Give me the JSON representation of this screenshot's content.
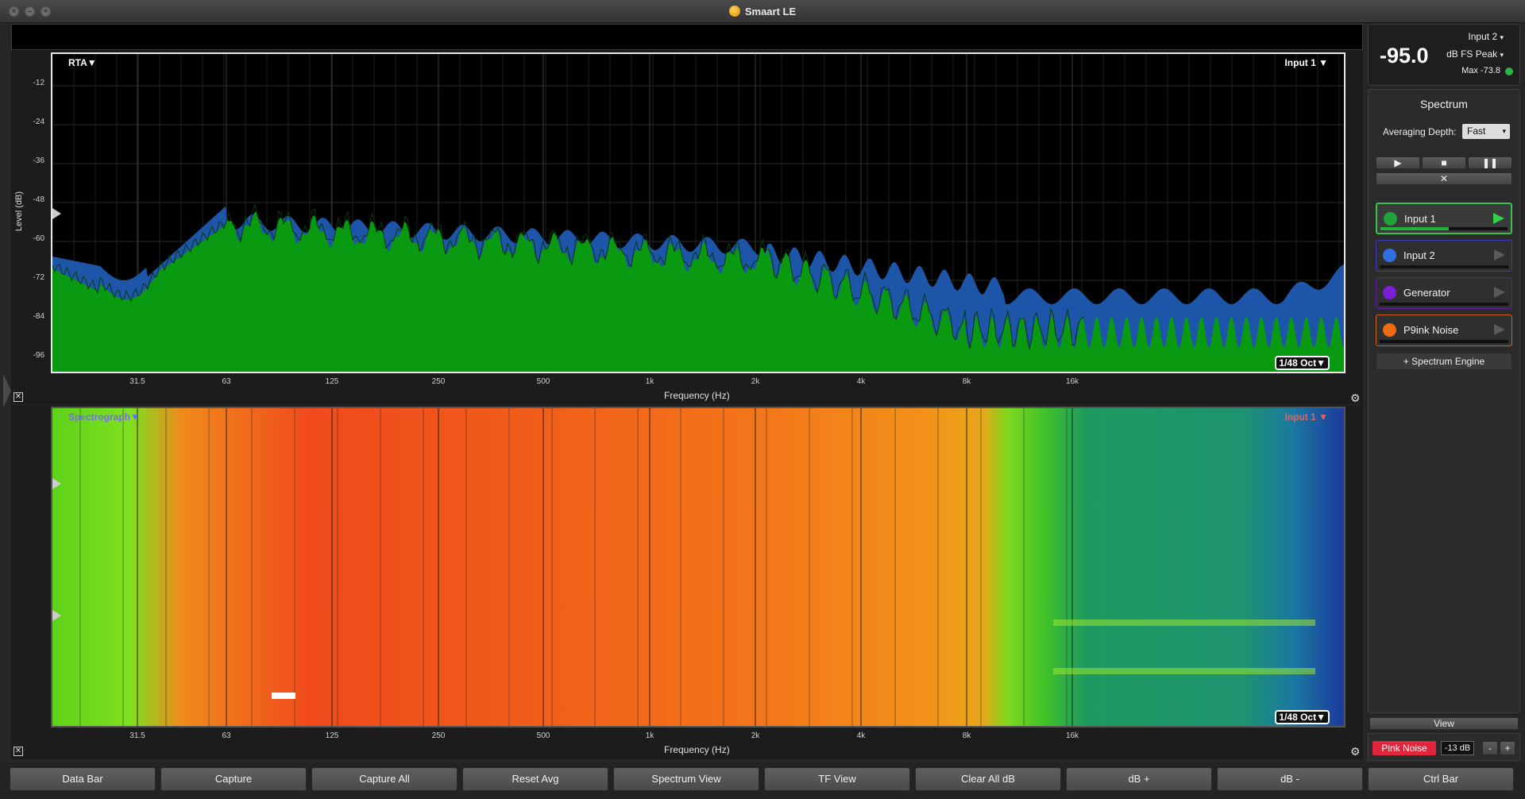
{
  "window": {
    "title": "Smaart LE"
  },
  "rta": {
    "mode_label": "RTA",
    "input_label": "Input 1",
    "resolution": "1/48 Oct",
    "y_axis_label": "Level (dB)",
    "y_ticks": [
      "-12",
      "-24",
      "-36",
      "-48",
      "-60",
      "-72",
      "-84",
      "-96"
    ],
    "x_ticks": [
      "31.5",
      "63",
      "125",
      "250",
      "500",
      "1k",
      "2k",
      "4k",
      "8k",
      "16k"
    ],
    "x_axis_label": "Frequency (Hz)"
  },
  "spectrograph": {
    "mode_label": "Spectrograph",
    "input_label": "Input 1",
    "resolution": "1/48 Oct",
    "x_ticks": [
      "31.5",
      "63",
      "125",
      "250",
      "500",
      "1k",
      "2k",
      "4k",
      "8k",
      "16k"
    ],
    "x_axis_label": "Frequency (Hz)"
  },
  "meter": {
    "value": "-95.0",
    "input": "Input 2",
    "unit": "dB FS Peak",
    "max": "Max -73.8",
    "status_color": "#2db34a"
  },
  "spectrum_panel": {
    "title": "Spectrum",
    "averaging_label": "Averaging Depth:",
    "averaging_value": "Fast",
    "channels": [
      {
        "label": "Input 1",
        "color": "#1fa33a",
        "border": "#39c24a"
      },
      {
        "label": "Input 2",
        "color": "#2f6fe0",
        "border": "#3b3bb8"
      },
      {
        "label": "Generator",
        "color": "#7a1fd6",
        "border": "#5a1f9a"
      },
      {
        "label": "P9ink Noise",
        "color": "#f06a10",
        "border": "#d2601a"
      }
    ],
    "add_engine": "+ Spectrum Engine",
    "view_label": "View",
    "pink_noise_label": "Pink Noise",
    "gen_level": "-13 dB",
    "minus": "-",
    "plus": "+"
  },
  "toolbar": {
    "buttons": [
      "Data Bar",
      "Capture",
      "Capture All",
      "Reset Avg",
      "Spectrum View",
      "TF View",
      "Clear All dB",
      "dB +",
      "dB -",
      "Ctrl Bar"
    ]
  }
}
